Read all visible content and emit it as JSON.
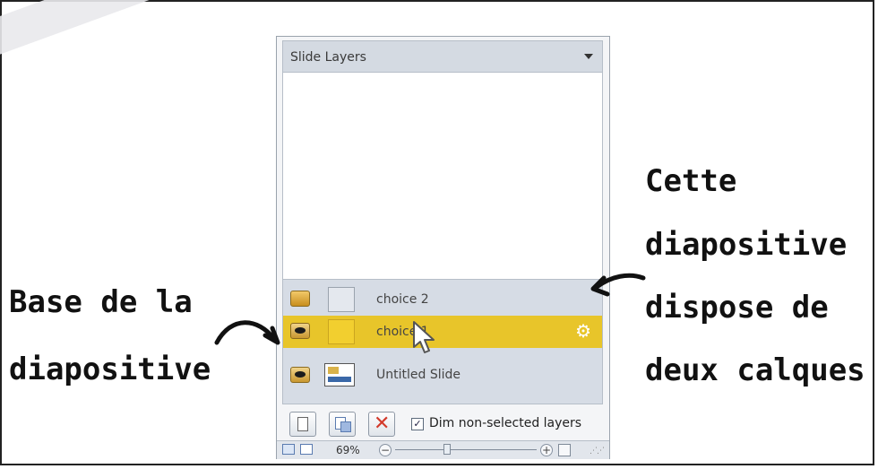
{
  "panel": {
    "title": "Slide Layers",
    "layers": [
      {
        "name": "choice 2",
        "visibility_icon": "layer-hidden-icon",
        "selected": false
      },
      {
        "name": "choice 1",
        "visibility_icon": "eye-icon",
        "selected": true,
        "has_settings": true
      },
      {
        "name": "Untitled Slide",
        "visibility_icon": "eye-icon",
        "selected": false,
        "is_base": true
      }
    ],
    "toolbar": {
      "checkbox_label": "Dim non-selected layers",
      "checkbox_checked": true,
      "checkbox_glyph": "✓"
    },
    "status": {
      "zoom": "69%"
    }
  },
  "annotations": {
    "left": [
      "Base de la",
      "diapositive"
    ],
    "right": [
      "Cette",
      "diapositive",
      "dispose de",
      "deux calques"
    ]
  },
  "colors": {
    "selected_row": "#e8c52a",
    "panel_bg": "#f4f5f7",
    "layer_list_bg": "#d6dce5"
  }
}
